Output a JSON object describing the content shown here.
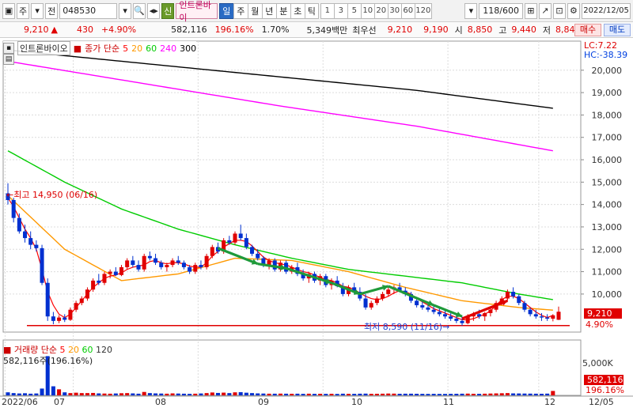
{
  "toolbar": {
    "period_label": "주",
    "prev_label": "전",
    "stock_code": "048530",
    "badge_label": "신",
    "stock_name": "인트론바이",
    "tabs": [
      "일",
      "주",
      "월",
      "년",
      "분",
      "초",
      "틱"
    ],
    "active_tab": "일",
    "numbers": [
      "1",
      "3",
      "5",
      "10",
      "20",
      "30",
      "60",
      "120"
    ],
    "count": "118/600",
    "date": "2022/12/05"
  },
  "quote": {
    "price": "9,210",
    "change": "430",
    "change_pct": "+4.90%",
    "volume": "582,116",
    "volume_pct": "196.16%",
    "turnover": "1.70%",
    "amount": "5,349백만",
    "best_bid_label": "최우선",
    "best_ask": "9,210",
    "best_bid": "9,190",
    "open_label": "시",
    "open": "8,850",
    "high_label": "고",
    "high": "9,440",
    "low_label": "저",
    "low": "8,840",
    "buy_label": "매수",
    "sell_label": "매도"
  },
  "legend": {
    "name": "인트론바이오",
    "price_label": "종가 단순",
    "ma": [
      {
        "period": "5",
        "color": "#ff0000"
      },
      {
        "period": "20",
        "color": "#ff9900"
      },
      {
        "period": "60",
        "color": "#00cc00"
      },
      {
        "period": "240",
        "color": "#ff00ff"
      },
      {
        "period": "300",
        "color": "#000000"
      }
    ]
  },
  "volume_legend": {
    "label": "거래량 단순",
    "ma": [
      {
        "period": "5",
        "color": "#ff0000"
      },
      {
        "period": "20",
        "color": "#ff9900"
      },
      {
        "period": "60",
        "color": "#00cc00"
      },
      {
        "period": "120",
        "color": "#333333"
      }
    ],
    "value": "582,116주(196.16%)"
  },
  "annotations": {
    "high_label": "최고 14,950 (06/16)",
    "low_label": "최저 8,590 (11/16)"
  },
  "right_axis": {
    "lc": "LC:7.22",
    "hc": "HC:-38.39",
    "current_price": "9,210",
    "current_pct": "4.90%",
    "volume_tick": "5,000K",
    "current_volume": "582,116",
    "current_volume_pct": "196.16%"
  },
  "chart_data": {
    "type": "candlestick",
    "y_ticks": [
      10000,
      11000,
      12000,
      13000,
      14000,
      15000,
      16000,
      17000,
      18000,
      19000,
      20000
    ],
    "y_tick_labels": [
      "10,000",
      "11,000",
      "12,000",
      "13,000",
      "14,000",
      "15,000",
      "16,000",
      "17,000",
      "18,000",
      "19,000",
      "20,000"
    ],
    "ylim": [
      8300,
      21300
    ],
    "x_labels": [
      "2022/06",
      "07",
      "08",
      "09",
      "10",
      "11",
      "12",
      "12/05"
    ],
    "candles": [
      [
        14500,
        14950,
        14000,
        14200
      ],
      [
        14200,
        14300,
        13200,
        13400
      ],
      [
        13400,
        13600,
        12700,
        12800
      ],
      [
        12800,
        13100,
        12300,
        12500
      ],
      [
        12500,
        12800,
        12000,
        12200
      ],
      [
        12200,
        12400,
        11900,
        12050
      ],
      [
        12050,
        12200,
        10400,
        10500
      ],
      [
        10500,
        10700,
        8800,
        9000
      ],
      [
        9000,
        9200,
        8650,
        8800
      ],
      [
        8800,
        9050,
        8700,
        8950
      ],
      [
        8950,
        9100,
        8750,
        8850
      ],
      [
        8850,
        9400,
        8800,
        9300
      ],
      [
        9300,
        9700,
        9200,
        9600
      ],
      [
        9600,
        9900,
        9500,
        9800
      ],
      [
        9800,
        10300,
        9700,
        10200
      ],
      [
        10200,
        10700,
        10100,
        10600
      ],
      [
        10600,
        10900,
        10400,
        10500
      ],
      [
        10500,
        11000,
        10400,
        10900
      ],
      [
        10900,
        11100,
        10700,
        11000
      ],
      [
        11000,
        11200,
        10800,
        10850
      ],
      [
        10850,
        11300,
        10800,
        11200
      ],
      [
        11200,
        11600,
        11100,
        11500
      ],
      [
        11500,
        11700,
        11200,
        11300
      ],
      [
        11300,
        11500,
        11000,
        11100
      ],
      [
        11100,
        11800,
        11000,
        11700
      ],
      [
        11700,
        11900,
        11500,
        11600
      ],
      [
        11600,
        11800,
        11300,
        11400
      ],
      [
        11400,
        11500,
        11100,
        11200
      ],
      [
        11200,
        11400,
        11000,
        11300
      ],
      [
        11300,
        11600,
        11200,
        11500
      ],
      [
        11500,
        11700,
        11300,
        11400
      ],
      [
        11400,
        11500,
        11100,
        11200
      ],
      [
        11200,
        11300,
        10900,
        11000
      ],
      [
        11000,
        11400,
        10900,
        11300
      ],
      [
        11300,
        11500,
        11100,
        11200
      ],
      [
        11200,
        11800,
        11100,
        11700
      ],
      [
        11700,
        12200,
        11600,
        12100
      ],
      [
        12100,
        12300,
        11800,
        11900
      ],
      [
        11900,
        12500,
        11800,
        12400
      ],
      [
        12400,
        12600,
        12200,
        12300
      ],
      [
        12300,
        12800,
        12200,
        12700
      ],
      [
        12700,
        13100,
        12400,
        12500
      ],
      [
        12500,
        12700,
        12000,
        12100
      ],
      [
        12100,
        12200,
        11700,
        11800
      ],
      [
        11800,
        12000,
        11500,
        11600
      ],
      [
        11600,
        11700,
        11200,
        11300
      ],
      [
        11300,
        11600,
        11100,
        11500
      ],
      [
        11500,
        11600,
        11000,
        11100
      ],
      [
        11100,
        11500,
        11000,
        11400
      ],
      [
        11400,
        11500,
        10900,
        11000
      ],
      [
        11000,
        11300,
        10900,
        11200
      ],
      [
        11200,
        11400,
        10800,
        10900
      ],
      [
        10900,
        11100,
        10600,
        10700
      ],
      [
        10700,
        11000,
        10500,
        10900
      ],
      [
        10900,
        11000,
        10500,
        10600
      ],
      [
        10600,
        10900,
        10400,
        10800
      ],
      [
        10800,
        10900,
        10300,
        10400
      ],
      [
        10400,
        10700,
        10200,
        10600
      ],
      [
        10600,
        10800,
        10300,
        10350
      ],
      [
        10350,
        10500,
        9900,
        10000
      ],
      [
        10000,
        10400,
        9900,
        10300
      ],
      [
        10300,
        10500,
        10000,
        10100
      ],
      [
        10100,
        10300,
        9700,
        9800
      ],
      [
        9800,
        10000,
        9300,
        9400
      ],
      [
        9400,
        9700,
        9300,
        9600
      ],
      [
        9600,
        9900,
        9500,
        9800
      ],
      [
        9800,
        10100,
        9700,
        10000
      ],
      [
        10000,
        10300,
        9900,
        10200
      ],
      [
        10200,
        10400,
        10000,
        10300
      ],
      [
        10300,
        10500,
        10100,
        10150
      ],
      [
        10150,
        10300,
        9900,
        10000
      ],
      [
        10000,
        10100,
        9600,
        9700
      ],
      [
        9700,
        9800,
        9400,
        9500
      ],
      [
        9500,
        9700,
        9300,
        9400
      ],
      [
        9400,
        9600,
        9200,
        9300
      ],
      [
        9300,
        9500,
        9100,
        9200
      ],
      [
        9200,
        9400,
        9000,
        9100
      ],
      [
        9100,
        9300,
        8900,
        9000
      ],
      [
        9000,
        9200,
        8800,
        8900
      ],
      [
        8900,
        9100,
        8700,
        8800
      ],
      [
        8800,
        9000,
        8590,
        8700
      ],
      [
        8700,
        9100,
        8650,
        9000
      ],
      [
        9000,
        9200,
        8800,
        9100
      ],
      [
        9100,
        9300,
        8900,
        9000
      ],
      [
        9000,
        9200,
        8800,
        9150
      ],
      [
        9150,
        9400,
        9000,
        9300
      ],
      [
        9300,
        9700,
        9200,
        9600
      ],
      [
        9600,
        9900,
        9500,
        9800
      ],
      [
        9800,
        10200,
        9700,
        10100
      ],
      [
        10100,
        10300,
        9800,
        9900
      ],
      [
        9900,
        10000,
        9500,
        9600
      ],
      [
        9600,
        9700,
        9200,
        9300
      ],
      [
        9300,
        9400,
        9000,
        9100
      ],
      [
        9100,
        9300,
        8900,
        9000
      ],
      [
        9000,
        9150,
        8800,
        8950
      ],
      [
        8950,
        9100,
        8800,
        8900
      ],
      [
        8900,
        9100,
        8780,
        9050
      ],
      [
        8850,
        9440,
        8840,
        9210
      ]
    ],
    "ma5": [
      14300,
      13900,
      13400,
      12900,
      12500,
      12000,
      11100,
      10100,
      9500,
      9100,
      8950,
      9100,
      9400,
      9700,
      10000,
      10300,
      10500,
      10700,
      10800,
      10850,
      10950,
      11100,
      11200,
      11250,
      11300,
      11450,
      11500,
      11400,
      11350,
      11400,
      11400,
      11350,
      11250,
      11200,
      11200,
      11400,
      11700,
      11900,
      12100,
      12250,
      12400,
      12400,
      12350,
      12150,
      11900,
      11650,
      11500,
      11400,
      11350,
      11300,
      11200,
      11100,
      11000,
      10950,
      10850,
      10750,
      10650,
      10600,
      10500,
      10350,
      10300,
      10200,
      10050,
      9900,
      9800,
      9750,
      9800,
      9900,
      10050,
      10150,
      10100,
      10000,
      9800,
      9650,
      9500,
      9350,
      9250,
      9150,
      9050,
      8950,
      8850,
      8850,
      8900,
      9000,
      9100,
      9250,
      9500,
      9750,
      9900,
      9900,
      9800,
      9600,
      9400,
      9200,
      9050,
      8950,
      9050
    ],
    "ma20_points": [
      [
        0,
        14400
      ],
      [
        10,
        12000
      ],
      [
        20,
        10600
      ],
      [
        30,
        10900
      ],
      [
        40,
        11600
      ],
      [
        50,
        11500
      ],
      [
        60,
        11000
      ],
      [
        70,
        10300
      ],
      [
        80,
        9700
      ],
      [
        90,
        9400
      ],
      [
        96,
        9280
      ]
    ],
    "ma60_points": [
      [
        0,
        16400
      ],
      [
        10,
        15000
      ],
      [
        20,
        13800
      ],
      [
        30,
        12900
      ],
      [
        40,
        12200
      ],
      [
        50,
        11600
      ],
      [
        60,
        11100
      ],
      [
        70,
        10800
      ],
      [
        80,
        10500
      ],
      [
        90,
        10000
      ],
      [
        96,
        9750
      ]
    ],
    "ma240_points": [
      [
        0,
        20400
      ],
      [
        24,
        19400
      ],
      [
        48,
        18400
      ],
      [
        72,
        17500
      ],
      [
        96,
        16400
      ]
    ],
    "ma300_points": [
      [
        0,
        20900
      ],
      [
        24,
        20300
      ],
      [
        48,
        19700
      ],
      [
        72,
        19100
      ],
      [
        96,
        18300
      ]
    ],
    "support_line": 8590,
    "volume": {
      "ylim": [
        0,
        6500
      ],
      "values": [
        400,
        300,
        250,
        280,
        220,
        250,
        900,
        5200,
        1200,
        800,
        400,
        300,
        350,
        300,
        300,
        320,
        260,
        240,
        220,
        250,
        280,
        300,
        260,
        220,
        450,
        300,
        260,
        240,
        220,
        260,
        240,
        220,
        200,
        220,
        250,
        300,
        380,
        320,
        360,
        300,
        400,
        420,
        350,
        300,
        260,
        240,
        220,
        220,
        230,
        220,
        210,
        220,
        200,
        220,
        200,
        210,
        200,
        210,
        190,
        220,
        200,
        200,
        220,
        230,
        200,
        210,
        220,
        240,
        230,
        210,
        220,
        220,
        210,
        200,
        190,
        200,
        190,
        190,
        200,
        210,
        220,
        230,
        210,
        200,
        220,
        240,
        260,
        280,
        300,
        260,
        250,
        240,
        230,
        220,
        210,
        230,
        582
      ]
    }
  }
}
